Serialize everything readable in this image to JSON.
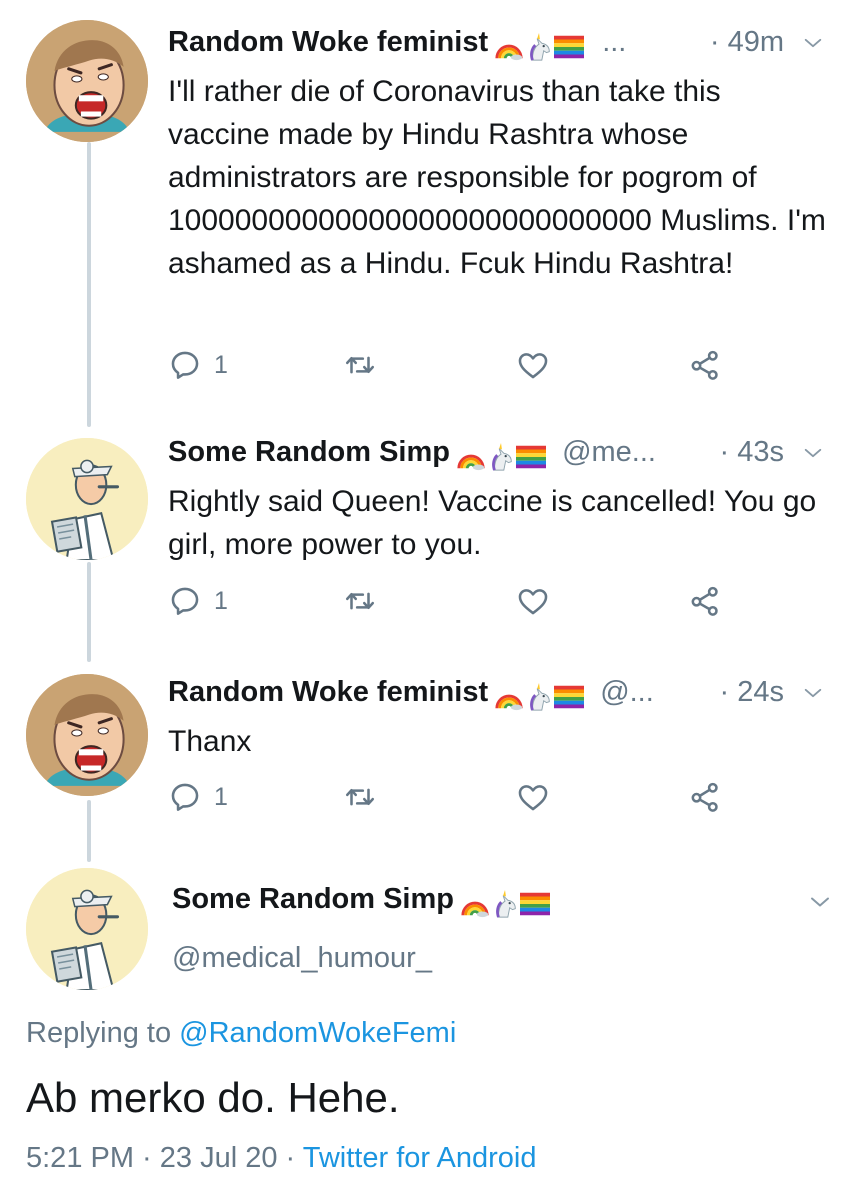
{
  "tweets": [
    {
      "name": "Random Woke feminist",
      "handle": "...",
      "time": "· 49m",
      "text": "I'll rather die of Coronavirus than take this vaccine made by Hindu Rashtra whose administrators are responsible for pogrom of 10000000000000000000000000000 Muslims. I'm ashamed as a Hindu. Fcuk Hindu Rashtra!",
      "replies": "1"
    },
    {
      "name": "Some Random Simp",
      "handle": "@me...",
      "time": "· 43s",
      "text": "Rightly said Queen! Vaccine is cancelled! You go girl, more power to you.",
      "replies": "1"
    },
    {
      "name": "Random Woke feminist",
      "handle": "@...",
      "time": "· 24s",
      "text": "Thanx",
      "replies": "1"
    }
  ],
  "main_tweet": {
    "name": "Some Random Simp",
    "handle": "@medical_humour_",
    "replying_prefix": "Replying to",
    "replying_handle": "@RandomWokeFemi",
    "text": "Ab merko do. Hehe.",
    "timestamp": "5:21 PM · 23 Jul 20 ·",
    "source": "Twitter for Android"
  },
  "icons": [
    "reply-icon",
    "retweet-icon",
    "like-icon",
    "share-icon",
    "chevron-down-icon",
    "rainbow-emoji",
    "unicorn-emoji",
    "pride-flag-emoji"
  ],
  "colors": {
    "text": "#14171a",
    "secondary": "#657786",
    "link": "#1b95e0",
    "thread_line": "#ccd6dd"
  }
}
